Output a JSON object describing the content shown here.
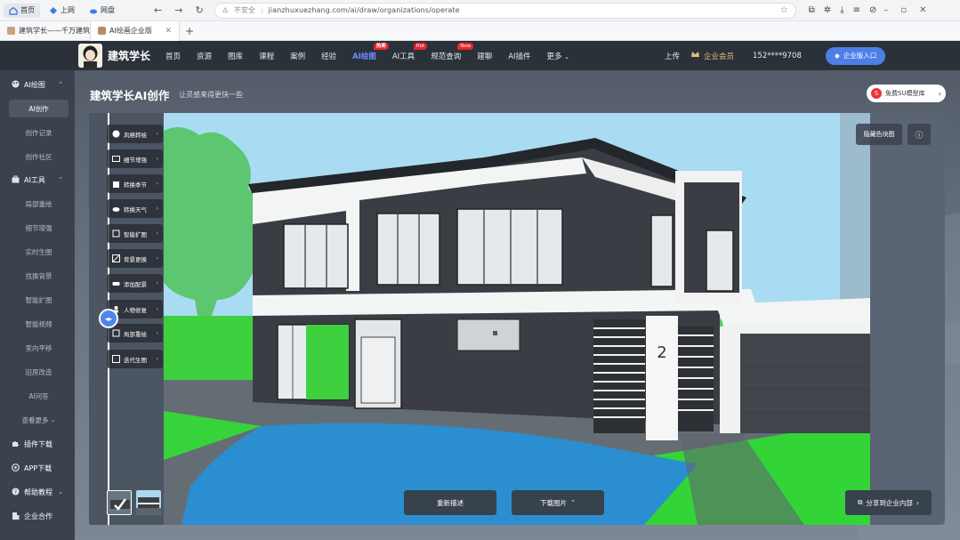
{
  "browser": {
    "nav": [
      {
        "label": "首页",
        "icon": "home-icon"
      },
      {
        "label": "上网",
        "icon": "globe-icon"
      },
      {
        "label": "网盘",
        "icon": "cloud-icon"
      }
    ],
    "url_secure": "不安全",
    "url": "jianzhuxuezhang.com/ai/draw/organizations/operate",
    "tabs": [
      {
        "label": "建筑学长——千万建筑设",
        "active": false
      },
      {
        "label": "AI绘画企业版",
        "active": true
      }
    ]
  },
  "header": {
    "site_name": "建筑学长",
    "menu": [
      {
        "label": "首页",
        "badge": ""
      },
      {
        "label": "资源",
        "badge": ""
      },
      {
        "label": "图库",
        "badge": ""
      },
      {
        "label": "课程",
        "badge": ""
      },
      {
        "label": "案例",
        "badge": ""
      },
      {
        "label": "经验",
        "badge": ""
      },
      {
        "label": "AI绘图",
        "badge": "热卖",
        "active": true
      },
      {
        "label": "AI工具",
        "badge": "Hot"
      },
      {
        "label": "规范查询",
        "badge": "New"
      },
      {
        "label": "建聊",
        "badge": ""
      },
      {
        "label": "AI插件",
        "badge": ""
      },
      {
        "label": "更多",
        "badge": ""
      }
    ],
    "upload": "上传",
    "vip": "企业会员",
    "phone": "152****9708",
    "enterprise_btn": "企业版入口"
  },
  "sidebar": {
    "groups": [
      {
        "label": "AI绘图",
        "icon": "palette-icon",
        "items": [
          "AI创作",
          "创作记录",
          "创作社区"
        ]
      },
      {
        "label": "AI工具",
        "icon": "toolbox-icon",
        "items": [
          "局部重绘",
          "细节增强",
          "实时生图",
          "找换背景",
          "智能扩图",
          "智能视频",
          "室内平移",
          "旧房改造",
          "AI问答",
          "查看更多"
        ]
      }
    ],
    "bottom": [
      {
        "label": "插件下载",
        "icon": "puzzle-icon"
      },
      {
        "label": "APP下载",
        "icon": "app-icon"
      },
      {
        "label": "帮助教程",
        "icon": "help-icon"
      },
      {
        "label": "企业合作",
        "icon": "building-icon"
      }
    ]
  },
  "main": {
    "title": "建筑学长AI创作",
    "subtitle": "让灵感来得更快一些",
    "free_lib": "免费SU模型库",
    "tools": [
      {
        "label": "风格转绘",
        "icon": "palette-icon"
      },
      {
        "label": "细节增强",
        "icon": "image-icon"
      },
      {
        "label": "转换季节",
        "icon": "building-icon"
      },
      {
        "label": "转换天气",
        "icon": "cloud-icon"
      },
      {
        "label": "智能扩图",
        "icon": "expand-icon"
      },
      {
        "label": "背景更换",
        "icon": "layers-icon"
      },
      {
        "label": "添加配景",
        "icon": "car-icon"
      },
      {
        "label": "人物修复",
        "icon": "person-icon"
      },
      {
        "label": "局部重绘",
        "icon": "brush-icon"
      },
      {
        "label": "迭代生图",
        "icon": "refresh-icon"
      }
    ],
    "mask_badge": "隐藏色块图",
    "buttons": {
      "regenerate": "重新描述",
      "download": "下载图片",
      "share": "分享到企业内部"
    },
    "house_number": "2"
  },
  "colors": {
    "accent": "#4f86e8",
    "header_bg": "#2b3139",
    "sidebar_bg": "#3b424d",
    "active_menu": "#6f8cff",
    "badge": "#e6262e"
  }
}
